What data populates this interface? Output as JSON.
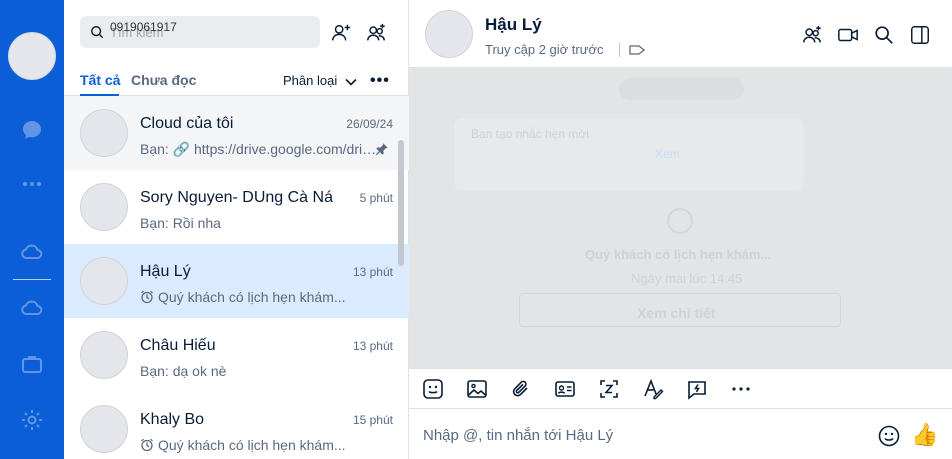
{
  "search": {
    "placeholder": "Tìm kiếm",
    "typed_overlay": "0919061917"
  },
  "tabs": {
    "all": "Tất cả",
    "unread": "Chưa đọc",
    "classify": "Phân loại",
    "more": "•••"
  },
  "conversations": [
    {
      "name": "Cloud của tôi",
      "time": "26/09/24",
      "preview": "Bạn: 🔗 https://drive.google.com/drive/folders",
      "pinned": true
    },
    {
      "name": "Sory Nguyen- DUng Cà Ná",
      "time": "5 phút",
      "preview": "Bạn: Rồi nha"
    },
    {
      "name": "Hậu Lý",
      "time": "13 phút",
      "preview": "Quý khách có lịch hẹn khám..."
    },
    {
      "name": "Châu Hiếu",
      "time": "13 phút",
      "preview": "Bạn: dạ ok nè"
    },
    {
      "name": "Khaly Bo",
      "time": "15 phút",
      "preview": "Quý khách có lịch hẹn khám..."
    }
  ],
  "chat": {
    "name": "Hậu Lý",
    "status": "Truy cập 2 giờ trước",
    "composer_placeholder": "Nhập @, tin nhắn tới Hậu Lý",
    "like": "👍",
    "ghost": {
      "reminder_title": "Bạn tạo nhắc hẹn mới",
      "view": "Xem",
      "message": "Quý khách có lịch hẹn khám...",
      "when": "Ngày mai lúc 14:45",
      "detail_button": "Xem chi tiết"
    }
  },
  "colors": {
    "rail": "#0b5ed7",
    "accent": "#0b5ed7",
    "active_row": "#dbebff",
    "chat_bg": "#e3e4e6"
  }
}
